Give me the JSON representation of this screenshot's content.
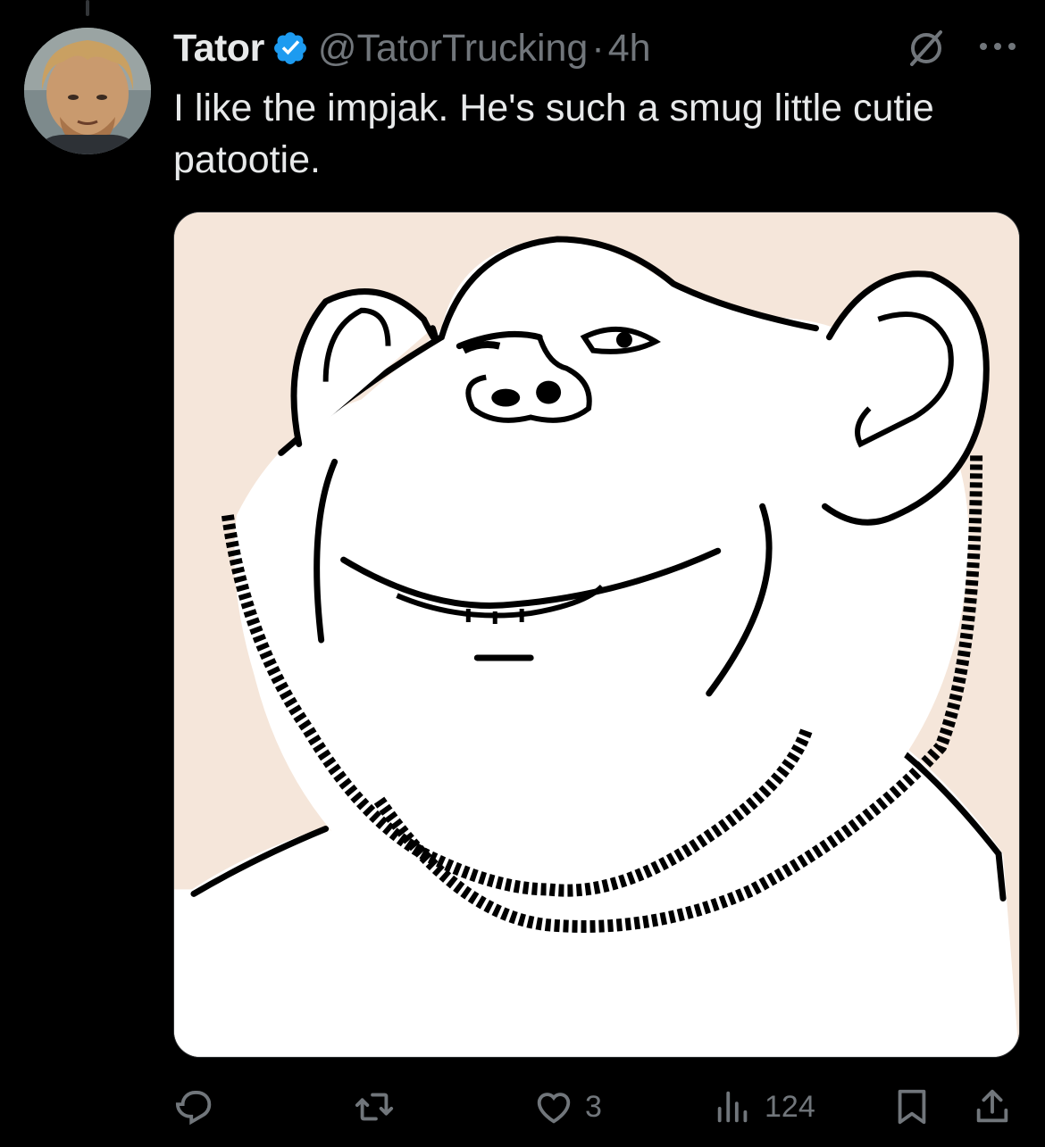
{
  "post": {
    "author": {
      "name": "Tator",
      "handle": "@TatorTrucking",
      "verified": true,
      "avatar": "avatar"
    },
    "separator": "·",
    "timestamp": "4h",
    "text": "I like the impjak. He's such a smug little cutie patootie.",
    "media": {
      "type": "image",
      "name": "impjak-drawing"
    }
  },
  "header_icons": [
    "grok-icon",
    "more-icon"
  ],
  "actions": {
    "reply": {
      "icon": "reply-icon"
    },
    "repost": {
      "icon": "repost-icon"
    },
    "like": {
      "icon": "heart-icon",
      "count": "3"
    },
    "views": {
      "icon": "views-icon",
      "count": "124"
    },
    "bookmark": {
      "icon": "bookmark-icon"
    },
    "share": {
      "icon": "share-icon"
    }
  },
  "colors": {
    "background": "#000000",
    "text_primary": "#e7e9ea",
    "text_secondary": "#71767b",
    "verified_badge": "#1d9bf0",
    "media_background": "#f5e6da"
  }
}
